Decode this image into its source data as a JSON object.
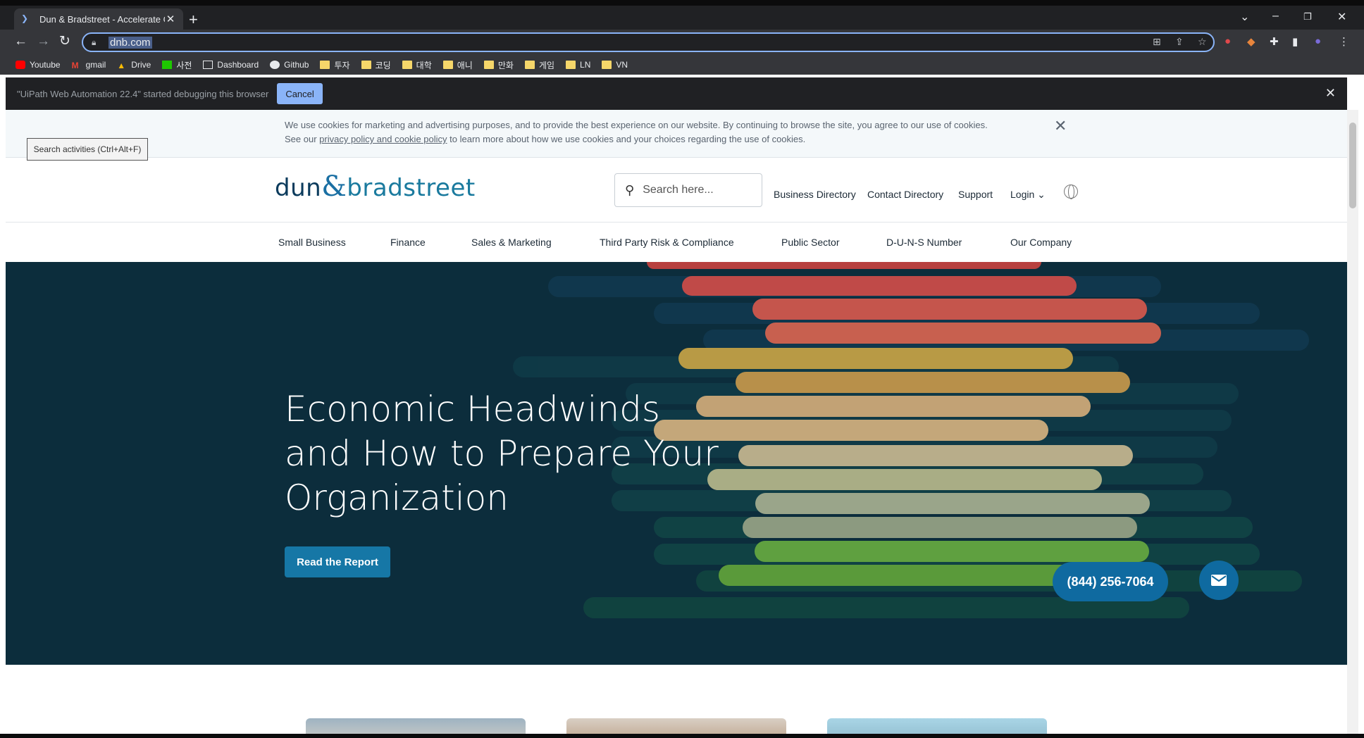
{
  "browser": {
    "tab_title": "Dun & Bradstreet - Accelerate Gr",
    "url": "dnb.com",
    "bookmarks": [
      "Youtube",
      "gmail",
      "Drive",
      "사전",
      "Dashboard",
      "Github",
      "투자",
      "코딩",
      "대학",
      "애니",
      "만화",
      "게임",
      "LN",
      "VN"
    ]
  },
  "debug_bar": {
    "message": "\"UiPath Web Automation 22.4\" started debugging this browser",
    "cancel_label": "Cancel"
  },
  "tooltip": "Search activities (Ctrl+Alt+F)",
  "cookie": {
    "text_1": "We use cookies for marketing and advertising purposes, and to provide the best experience on our website. By continuing to browse the site, you agree to our use of cookies. See our ",
    "link": "privacy policy and cookie policy",
    "text_2": " to learn more about how we use cookies and your choices regarding the use of cookies."
  },
  "header": {
    "logo_dun": "dun",
    "logo_amp": "&",
    "logo_brad": "bradstreet",
    "search_placeholder": "Search here...",
    "links": [
      "Business Directory",
      "Contact Directory",
      "Support",
      "Login"
    ]
  },
  "nav": [
    "Small Business",
    "Finance",
    "Sales & Marketing",
    "Third Party Risk & Compliance",
    "Public Sector",
    "D-U-N-S Number",
    "Our Company"
  ],
  "hero": {
    "title_1": "Economic Headwinds",
    "title_2": "and How to Prepare Your",
    "title_3": "Organization",
    "cta": "Read the Report"
  },
  "contact": {
    "phone": "(844) 256-7064"
  },
  "colors": {
    "brand_blue": "#0f6aa0",
    "hero_bg": "#0c2d3c",
    "chrome_dark": "#202124"
  }
}
